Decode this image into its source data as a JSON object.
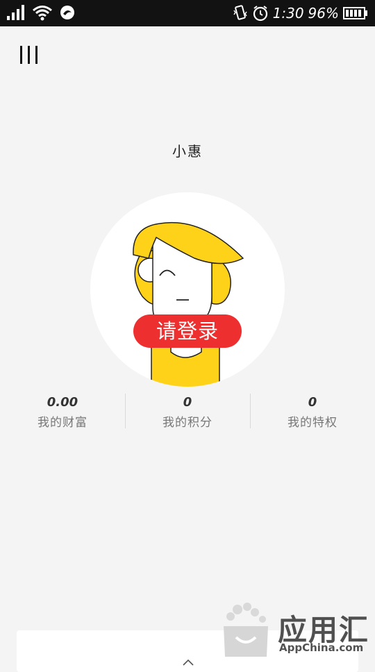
{
  "status_bar": {
    "time": "1:30",
    "battery": "96%",
    "icons": [
      "signal-icon",
      "wifi-icon",
      "app-notification-icon",
      "vibrate-icon",
      "alarm-icon",
      "battery-icon"
    ]
  },
  "header": {
    "menu_icon": "hamburger-menu-icon",
    "title": "小惠"
  },
  "profile": {
    "avatar": "cartoon-avatar",
    "login_label": "请登录",
    "login_color": "#ee2f2f"
  },
  "stats": [
    {
      "value": "0.00",
      "label": "我的财富"
    },
    {
      "value": "0",
      "label": "我的积分"
    },
    {
      "value": "0",
      "label": "我的特权"
    }
  ],
  "bottom_panel": {
    "icon": "chevron-up-icon"
  },
  "watermark": {
    "title": "应用汇",
    "subtitle": "AppChina.com"
  }
}
